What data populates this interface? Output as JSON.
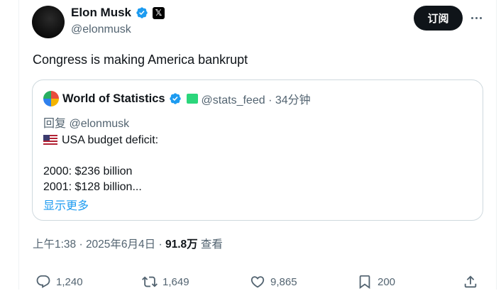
{
  "author": {
    "display_name": "Elon Musk",
    "handle": "@elonmusk",
    "x_badge": "𝕏"
  },
  "header": {
    "subscribe_label": "订阅"
  },
  "tweet": {
    "text": "Congress is making America bankrupt"
  },
  "quote": {
    "display_name": "World of Statistics",
    "handle_time": "@stats_feed · 34分钟",
    "reply_line": "回复 @elonmusk",
    "body_lines": [
      "USA budget deficit:",
      "",
      "2000: $236 billion",
      "2001: $128 billion..."
    ],
    "show_more": "显示更多"
  },
  "meta": {
    "timestamp": "上午1:38 · 2025年6月4日 · ",
    "views_count": "91.8万",
    "views_label": " 查看"
  },
  "actions": {
    "replies": "1,240",
    "reposts": "1,649",
    "likes": "9,865",
    "bookmarks": "200"
  },
  "colors": {
    "verified": "#1d9bf0",
    "link": "#1d9bf0",
    "muted": "#536471"
  }
}
